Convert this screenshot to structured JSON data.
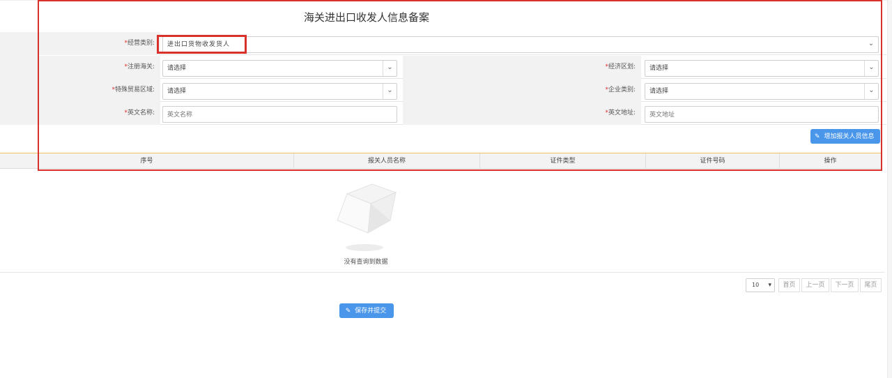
{
  "form": {
    "title": "海关进出口收发人信息备案",
    "business_type": {
      "label": "经营类别:",
      "value": "进出口货物收发货人"
    },
    "customs": {
      "label": "注册海关:",
      "value": "请选择"
    },
    "economic_zone": {
      "label": "经济区划:",
      "value": "请选择"
    },
    "special_zone": {
      "label": "特殊贸易区域:",
      "value": "请选择"
    },
    "company_type": {
      "label": "企业类别:",
      "value": "请选择"
    },
    "english_name": {
      "label": "英文名称:",
      "placeholder": "英文名称"
    },
    "english_address": {
      "label": "英文地址:",
      "placeholder": "英文地址"
    },
    "required_mark": "*"
  },
  "toolbar": {
    "add_label": "增加报关人员信息"
  },
  "table": {
    "columns": [
      "序号",
      "报关人员名称",
      "证件类型",
      "证件号码",
      "操作"
    ],
    "rows": [],
    "empty_text": "没有查询到数据"
  },
  "pagination": {
    "page_size": "10",
    "first": "首页",
    "prev": "上一页",
    "next": "下一页",
    "last": "尾页"
  },
  "actions": {
    "save_label": "保存并提交"
  },
  "colors": {
    "accent": "#4a96ea",
    "highlight": "#d9302c",
    "required": "#e03030"
  }
}
